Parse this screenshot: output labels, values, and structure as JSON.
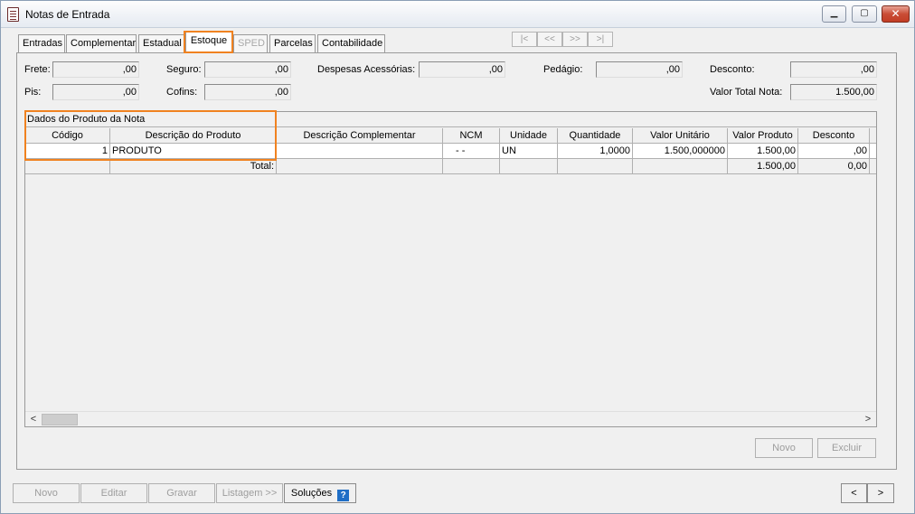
{
  "window": {
    "title": "Notas de Entrada",
    "minimize_glyph": "▁",
    "maximize_glyph": "▢",
    "close_glyph": "✕"
  },
  "tabs": [
    {
      "label": "Entradas",
      "state": "normal"
    },
    {
      "label": "Complementar",
      "state": "normal"
    },
    {
      "label": "Estadual",
      "state": "normal"
    },
    {
      "label": "Estoque",
      "state": "active"
    },
    {
      "label": "SPED",
      "state": "disabled"
    },
    {
      "label": "Parcelas",
      "state": "normal"
    },
    {
      "label": "Contabilidade",
      "state": "normal"
    }
  ],
  "record_nav": {
    "first": "|<",
    "prev": "<<",
    "next": ">>",
    "last": ">|"
  },
  "totals": {
    "frete_label": "Frete:",
    "frete_value": ",00",
    "seguro_label": "Seguro:",
    "seguro_value": ",00",
    "despesas_label": "Despesas Acessórias:",
    "despesas_value": ",00",
    "pedagio_label": "Pedágio:",
    "pedagio_value": ",00",
    "desconto_label": "Desconto:",
    "desconto_value": ",00",
    "pis_label": "Pis:",
    "pis_value": ",00",
    "cofins_label": "Cofins:",
    "cofins_value": ",00",
    "valor_total_label": "Valor Total Nota:",
    "valor_total_value": "1.500,00"
  },
  "grid": {
    "caption": "Dados do Produto da Nota",
    "headers": [
      "Código",
      "Descrição do Produto",
      "Descrição Complementar",
      "NCM",
      "Unidade",
      "Quantidade",
      "Valor Unitário",
      "Valor Produto",
      "Desconto"
    ],
    "rows": [
      [
        "1",
        "PRODUTO",
        "",
        "- -",
        "UN",
        "1,0000",
        "1.500,000000",
        "1.500,00",
        ",00"
      ]
    ],
    "total_row": {
      "label": "Total:",
      "valor_produto": "1.500,00",
      "desconto": "0,00"
    },
    "scroll_left": "<",
    "scroll_right": ">"
  },
  "panel_buttons": {
    "novo": "Novo",
    "excluir": "Excluir"
  },
  "footer": {
    "novo": "Novo",
    "editar": "Editar",
    "gravar": "Gravar",
    "listagem": "Listagem >>",
    "solucoes": "Soluções",
    "help": "?",
    "prev": "<",
    "next": ">"
  },
  "colors": {
    "highlight": "#f08220",
    "help_icon": "#1f6ec6"
  }
}
